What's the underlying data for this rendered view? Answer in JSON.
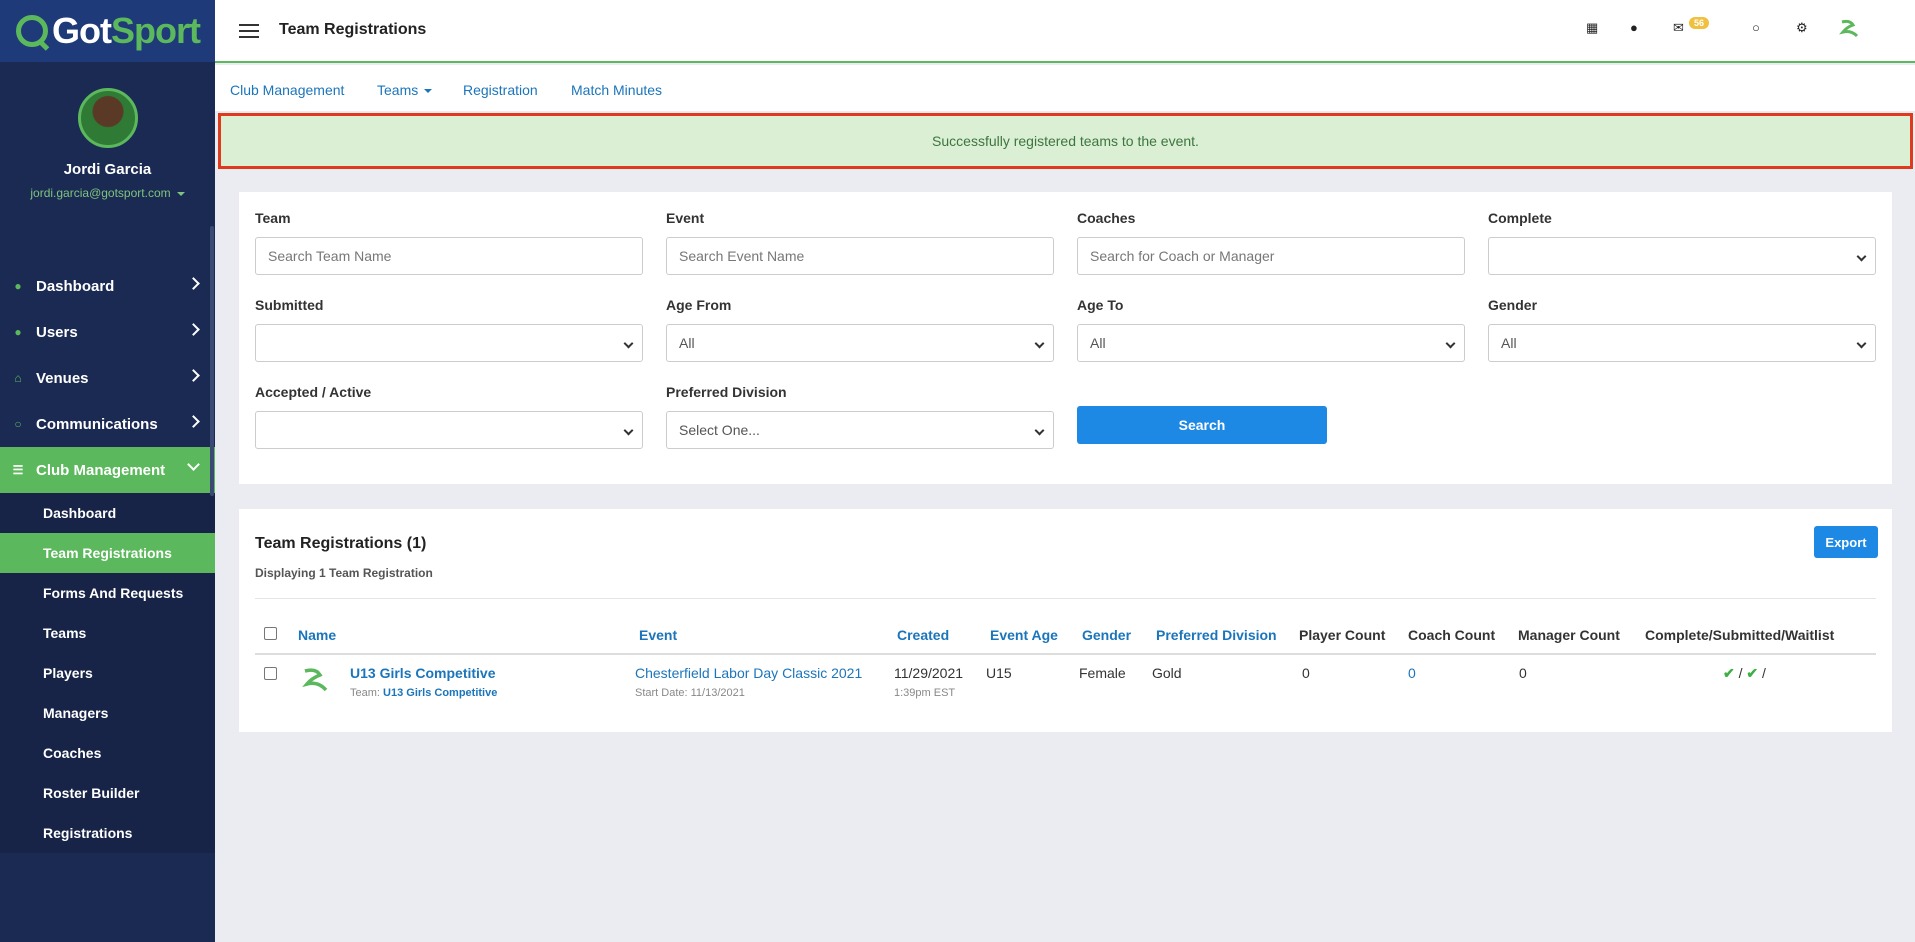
{
  "brand": {
    "logo_main": "Got",
    "logo_accent": "Sport"
  },
  "user": {
    "name": "Jordi Garcia",
    "email": "jordi.garcia@gotsport.com"
  },
  "sidebar": {
    "nav": [
      {
        "label": "Dashboard",
        "icon": "dashboard-icon"
      },
      {
        "label": "Users",
        "icon": "users-icon"
      },
      {
        "label": "Venues",
        "icon": "home-icon"
      },
      {
        "label": "Communications",
        "icon": "chat-icon"
      },
      {
        "label": "Club Management",
        "icon": "list-icon"
      }
    ],
    "sub": [
      "Dashboard",
      "Team Registrations",
      "Forms And Requests",
      "Teams",
      "Players",
      "Managers",
      "Coaches",
      "Roster Builder",
      "Registrations"
    ]
  },
  "topbar": {
    "title": "Team Registrations",
    "mail_badge": "56"
  },
  "subnav": [
    "Club Management",
    "Teams",
    "Registration",
    "Match Minutes"
  ],
  "alert": "Successfully registered teams to the event.",
  "filters": {
    "team": {
      "label": "Team",
      "placeholder": "Search Team Name"
    },
    "event": {
      "label": "Event",
      "placeholder": "Search Event Name"
    },
    "coaches": {
      "label": "Coaches",
      "placeholder": "Search for Coach or Manager"
    },
    "complete": {
      "label": "Complete",
      "value": ""
    },
    "submitted": {
      "label": "Submitted",
      "value": ""
    },
    "age_from": {
      "label": "Age From",
      "value": "All"
    },
    "age_to": {
      "label": "Age To",
      "value": "All"
    },
    "gender": {
      "label": "Gender",
      "value": "All"
    },
    "accepted": {
      "label": "Accepted / Active",
      "value": ""
    },
    "division": {
      "label": "Preferred Division",
      "value": "Select One..."
    },
    "search_label": "Search"
  },
  "results": {
    "title": "Team Registrations (1)",
    "subtitle": "Displaying 1 Team Registration",
    "export_label": "Export",
    "columns": [
      "Name",
      "Event",
      "Created",
      "Event Age",
      "Gender",
      "Preferred Division",
      "Player Count",
      "Coach Count",
      "Manager Count",
      "Complete/Submitted/Waitlist"
    ],
    "rows": [
      {
        "name": "U13 Girls Competitive",
        "team_prefix": "Team:",
        "team_name": "U13 Girls Competitive",
        "event": "Chesterfield Labor Day Classic 2021",
        "start_date": "Start Date: 11/13/2021",
        "created_date": "11/29/2021",
        "created_time": "1:39pm EST",
        "event_age": "U15",
        "gender": "Female",
        "division": "Gold",
        "player_count": "0",
        "coach_count": "0",
        "manager_count": "0",
        "status_sep": "/"
      }
    ]
  }
}
